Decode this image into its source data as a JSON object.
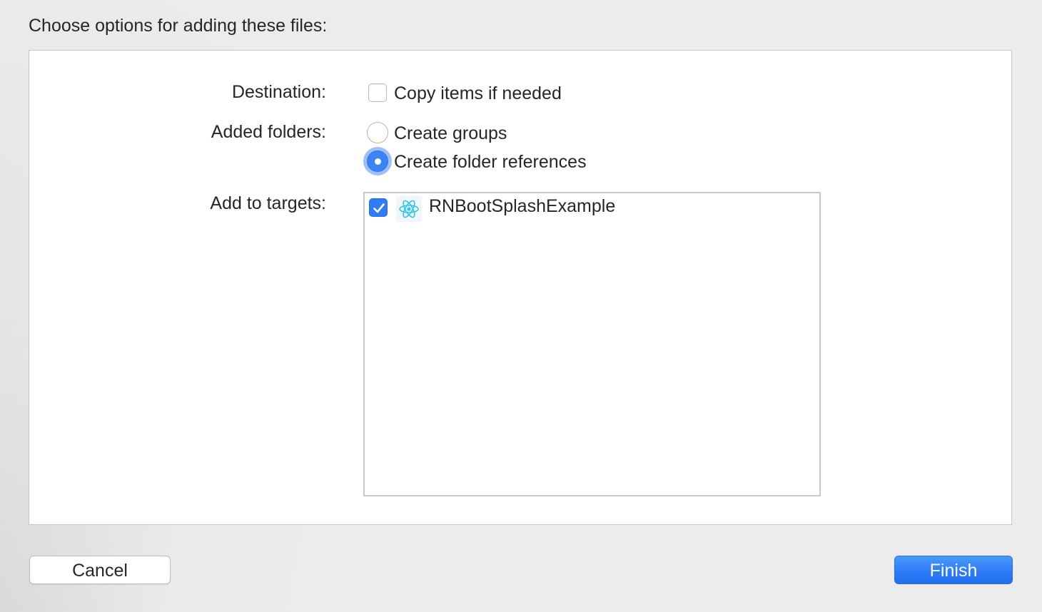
{
  "dialog": {
    "header": "Choose options for adding these files:"
  },
  "destination": {
    "label": "Destination:",
    "copy_items_label": "Copy items if needed",
    "copy_items_checked": false
  },
  "added_folders": {
    "label": "Added folders:",
    "options": [
      {
        "label": "Create groups",
        "selected": false
      },
      {
        "label": "Create folder references",
        "selected": true
      }
    ]
  },
  "targets": {
    "label": "Add to targets:",
    "items": [
      {
        "name": "RNBootSplashExample",
        "checked": true,
        "icon": "react-icon"
      }
    ]
  },
  "buttons": {
    "cancel": "Cancel",
    "finish": "Finish"
  },
  "colors": {
    "accent": "#2f7cf6",
    "react_icon": "#61dafb"
  }
}
